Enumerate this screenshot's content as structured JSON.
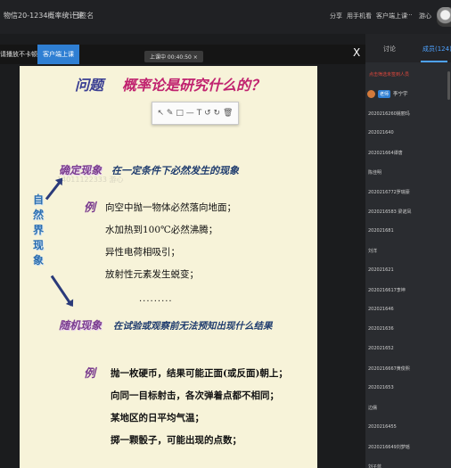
{
  "topbar": {
    "title": "物信20-1234概率统计课",
    "status": "✓ 已签名",
    "menu": [
      "分享",
      "用手机看",
      "客户端上课",
      "···",
      "游心"
    ]
  },
  "video_header": {
    "corner_label": "请播放不卡顿",
    "live_button": "客户端上课",
    "close_symbol": "X"
  },
  "pager": "上课中 00:40:50 ×",
  "slide": {
    "title_left": "问题",
    "title_right": "概率论是研究什么的？",
    "toolbar_icons": [
      "select-icon",
      "pen-icon",
      "rect-icon",
      "line-icon",
      "text-icon",
      "undo-icon",
      "redo-icon",
      "trash-icon"
    ],
    "toolbar_glyphs": [
      "↖",
      "✎",
      "□",
      "—",
      "T",
      "↺",
      "↻",
      "🗑"
    ],
    "watermark": "14011122333 游心",
    "deterministic_label": "确定现象",
    "deterministic_desc": "在一定条件下必然发生的现象",
    "vertical_label": "自然界现象",
    "example_mark": "例",
    "example1_items": [
      "向空中抛一物体必然落向地面；",
      "水加热到100℃必然沸腾；",
      "异性电荷相吸引；",
      "放射性元素发生蜕变；"
    ],
    "ellipsis": ".........",
    "random_label": "随机现象",
    "random_desc": "在试验或观察前无法预知出现什么结果",
    "example2_items": [
      "抛一枚硬币，结果可能正面(或反面)朝上；",
      "向同一目标射击，各次弹着点都不相同；",
      "某地区的日平均气温；",
      "掷一颗骰子，可能出现的点数；"
    ]
  },
  "panel": {
    "tab_discuss": "讨论",
    "tab_members": "成员(124)",
    "filter_text": "点击筛选未签到人员",
    "self_badge": "老师",
    "self_name": "李宁宇",
    "members": [
      "2020216260姚丽玛",
      "202021640",
      "202021664谭唐",
      "陈佳明",
      "2020216772罗瑞豪",
      "2020216583 梁诺凤",
      "202021681",
      "刘洋",
      "202021621",
      "2020216617李坤",
      "202021646",
      "202021636",
      "202021652",
      "2020216667黄俊熙",
      "202021653",
      "边儒",
      "2020216455",
      "2020216649刘梦瑶",
      "刘子蓝"
    ]
  },
  "colors": {
    "accent": "#2f7fd3",
    "slide_bg": "#f7f3d9",
    "title_blue": "#3b3f93",
    "title_magenta": "#c0226f",
    "label_purple": "#7b3d8f"
  }
}
